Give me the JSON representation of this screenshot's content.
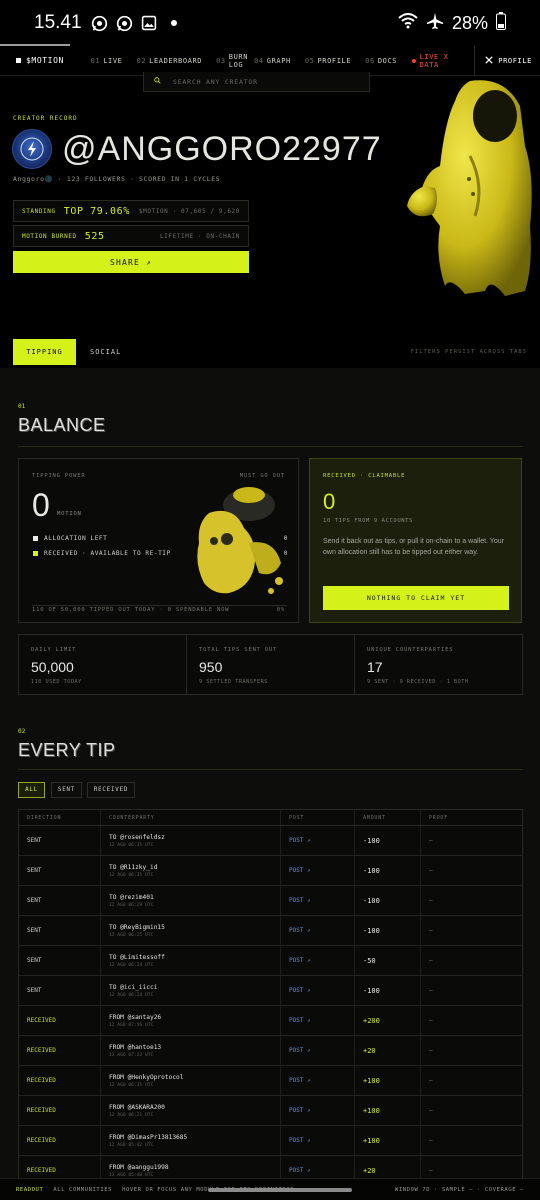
{
  "status": {
    "time": "15.41",
    "battery": "28%"
  },
  "nav": {
    "brand": "$MOTION",
    "items": [
      {
        "num": "01",
        "label": "LIVE"
      },
      {
        "num": "02",
        "label": "LEADERBOARD"
      },
      {
        "num": "03",
        "label": "BURN LOG"
      },
      {
        "num": "04",
        "label": "GRAPH"
      },
      {
        "num": "05",
        "label": "PROFILE"
      },
      {
        "num": "06",
        "label": "DOCS"
      }
    ],
    "live": "LIVE X DATA",
    "profile": "PROFILE"
  },
  "search": {
    "placeholder": "SEARCH ANY CREATOR"
  },
  "hero": {
    "creator_label": "CREATOR RECORD",
    "handle": "@ANGGORO22977",
    "meta": "Anggoro🌑 · 123 FOLLOWERS · SCORED IN 1 CYCLES",
    "standing_label": "STANDING",
    "standing_value": "TOP 79.06%",
    "standing_right": "$MOTION · 07,605 / 9,620",
    "burned_label": "MOTION BURNED",
    "burned_value": "525",
    "burned_right": "LIFETIME · ON-CHAIN",
    "share": "SHARE ↗"
  },
  "tabs": {
    "active": "TIPPING",
    "other": "SOCIAL",
    "hint": "FILTERS PERSIST ACROSS TABS"
  },
  "balance": {
    "num": "01",
    "title": "BALANCE",
    "power_label": "TIPPING POWER",
    "must_go_out": "MUST GO OUT",
    "power_value": "0",
    "power_unit": "MOTION",
    "allocation_label": "ALLOCATION LEFT",
    "allocation_value": "0",
    "received_label": "RECEIVED · AVAILABLE TO RE-TIP",
    "received_value": "0",
    "footer_left": "110 OF 50,000 TIPPED OUT TODAY · 0 SPENDABLE NOW",
    "footer_right": "0%",
    "claim_label": "RECEIVED · CLAIMABLE",
    "claim_value": "0",
    "claim_sub": "10 TIPS FROM 9 ACCOUNTS",
    "claim_desc": "Send it back out as tips, or pull it on-chain to a wallet. Your own allocation still has to be tipped out either way.",
    "claim_button": "NOTHING TO CLAIM YET"
  },
  "stats": [
    {
      "label": "DAILY LIMIT",
      "value": "50,000",
      "sub": "110 USED TODAY"
    },
    {
      "label": "TOTAL TIPS SENT OUT",
      "value": "950",
      "sub": "9 SETTLED TRANSFERS"
    },
    {
      "label": "UNIQUE COUNTERPARTIES",
      "value": "17",
      "sub": "9 SENT · 9 RECEIVED · 1 BOTH"
    }
  ],
  "tips": {
    "num": "02",
    "title": "EVERY TIP",
    "filters": [
      "ALL",
      "SENT",
      "RECEIVED"
    ],
    "columns": [
      "DIRECTION",
      "COUNTERPARTY",
      "POST",
      "AMOUNT",
      "PROOF"
    ],
    "rows": [
      {
        "dir": "SENT",
        "who": "TO @rosenfeldsz",
        "when": "12 AGO 06:35 UTC",
        "post": "POST ↗",
        "amount": "-100",
        "proof": "—"
      },
      {
        "dir": "SENT",
        "who": "TO @R11zky_id",
        "when": "12 AGO 06:35 UTC",
        "post": "POST ↗",
        "amount": "-100",
        "proof": "—"
      },
      {
        "dir": "SENT",
        "who": "TO @rezim401",
        "when": "12 AGO 06:29 UTC",
        "post": "POST ↗",
        "amount": "-100",
        "proof": "—"
      },
      {
        "dir": "SENT",
        "who": "TO @ReyBigmin15",
        "when": "12 AGO 06:25 UTC",
        "post": "POST ↗",
        "amount": "-100",
        "proof": "—"
      },
      {
        "dir": "SENT",
        "who": "TO @Limitessoff",
        "when": "12 AGO 06:24 UTC",
        "post": "POST ↗",
        "amount": "-50",
        "proof": "—"
      },
      {
        "dir": "SENT",
        "who": "TO @ici_iicci",
        "when": "12 AGO 06:24 UTC",
        "post": "POST ↗",
        "amount": "-100",
        "proof": "—"
      },
      {
        "dir": "RECEIVED",
        "who": "FROM @santay26",
        "when": "12 AGO 07:56 UTC",
        "post": "POST ↗",
        "amount": "+200",
        "proof": "—"
      },
      {
        "dir": "RECEIVED",
        "who": "FROM @hantoe13",
        "when": "12 AGO 07:22 UTC",
        "post": "POST ↗",
        "amount": "+20",
        "proof": "—"
      },
      {
        "dir": "RECEIVED",
        "who": "FROM @HenkyOprotocol",
        "when": "12 AGO 06:35 UTC",
        "post": "POST ↗",
        "amount": "+100",
        "proof": "—"
      },
      {
        "dir": "RECEIVED",
        "who": "FROM @ASKARA200",
        "when": "12 AGO 06:21 UTC",
        "post": "POST ↗",
        "amount": "+100",
        "proof": "—"
      },
      {
        "dir": "RECEIVED",
        "who": "FROM @DimasPr13813685",
        "when": "12 AGO 05:42 UTC",
        "post": "POST ↗",
        "amount": "+100",
        "proof": "—"
      },
      {
        "dir": "RECEIVED",
        "who": "FROM @aanggu1998",
        "when": "12 AGO 05:40 UTC",
        "post": "POST ↗",
        "amount": "+20",
        "proof": "—"
      }
    ]
  },
  "bottom": {
    "readout": "READOUT",
    "communities": "ALL COMMUNITIES",
    "hint": "HOVER OR FOCUS ANY MODULE FOR ITS DEFINITION",
    "right": "WINDOW 7D · SAMPLE — · COVERAGE —"
  }
}
